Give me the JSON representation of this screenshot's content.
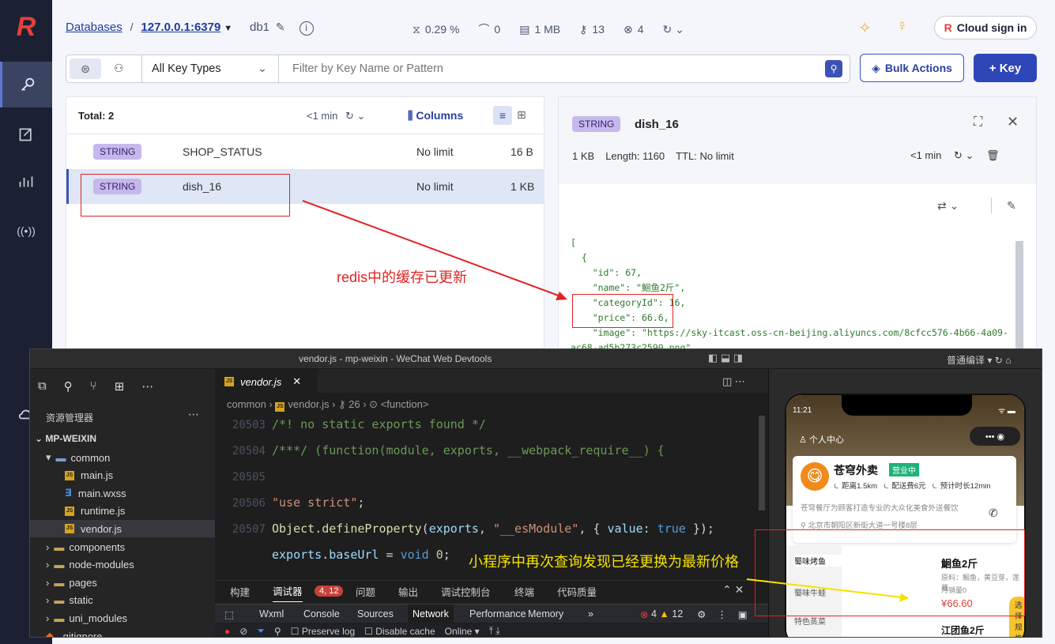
{
  "topbar": {
    "databases": "Databases",
    "sep": "/",
    "host": "127.0.0.1:6379",
    "db": "db1",
    "cpu": "0.29 %",
    "ops": "0",
    "mem": "1 MB",
    "keys": "13",
    "clients": "4",
    "cloud": "Cloud sign in"
  },
  "filter": {
    "type": "All Key Types",
    "placeholder": "Filter by Key Name or Pattern",
    "bulk": "Bulk Actions",
    "add": "+ Key"
  },
  "list": {
    "total": "Total: 2",
    "refresh": "<1 min",
    "columns": "Columns",
    "rows": [
      {
        "type": "STRING",
        "name": "SHOP_STATUS",
        "ttl": "No limit",
        "size": "16 B"
      },
      {
        "type": "STRING",
        "name": "dish_16",
        "ttl": "No limit",
        "size": "1 KB"
      }
    ]
  },
  "detail": {
    "type": "STRING",
    "key": "dish_16",
    "size": "1 KB",
    "length": "Length: 1160",
    "ttl": "TTL:  No limit",
    "refresh": "<1 min",
    "json": [
      "[",
      "  {",
      "    \"id\": 67,",
      "    \"name\": \"鮰鱼2斤\",",
      "    \"categoryId\": 16,",
      "    \"price\": 66.6,",
      "    \"image\": \"https://sky-itcast.oss-cn-beijing.aliyuncs.com/8cfcc576-4b66-4a09-",
      "ac68-ad5b273c2590.png\","
    ]
  },
  "annotation1": "redis中的缓存已更新",
  "annotation2": "小程序中再次查询发现已经更换为最新价格",
  "devtools": {
    "title": "vendor.js - mp-weixin - WeChat Web Devtools",
    "tab": "vendor.js",
    "breadcrumb": [
      "common",
      "vendor.js",
      "26",
      "<function>"
    ],
    "explorer": "资源管理器",
    "root": "MP-WEIXIN",
    "tree": [
      {
        "label": "common",
        "indent": 1,
        "kind": "folder-open"
      },
      {
        "label": "main.js",
        "indent": 2,
        "kind": "js"
      },
      {
        "label": "main.wxss",
        "indent": 2,
        "kind": "css"
      },
      {
        "label": "runtime.js",
        "indent": 2,
        "kind": "js"
      },
      {
        "label": "vendor.js",
        "indent": 2,
        "kind": "js"
      },
      {
        "label": "components",
        "indent": 1,
        "kind": "folder"
      },
      {
        "label": "node-modules",
        "indent": 1,
        "kind": "folder"
      },
      {
        "label": "pages",
        "indent": 1,
        "kind": "folder"
      },
      {
        "label": "static",
        "indent": 1,
        "kind": "folder"
      },
      {
        "label": "uni_modules",
        "indent": 1,
        "kind": "folder"
      },
      {
        "label": ".gitignore",
        "indent": 1,
        "kind": "file"
      }
    ],
    "lines": [
      {
        "n": "20503",
        "t": "/*! no static exports found */"
      },
      {
        "n": "20504",
        "t": "/***/ (function(module, exports, __webpack_require__) {"
      },
      {
        "n": "20505",
        "t": ""
      },
      {
        "n": "20506",
        "t": "\"use strict\";"
      },
      {
        "n": "20507",
        "t": "Object.defineProperty(exports, \"__esModule\", { value: true });"
      },
      {
        "n": "",
        "t": "exports.baseUrl = void 0;"
      }
    ],
    "paneltabs": [
      "构建",
      "调试器",
      "问题",
      "输出",
      "调试控制台",
      "终端",
      "代码质量"
    ],
    "badge": "4, 12",
    "tools": [
      "Wxml",
      "Console",
      "Sources",
      "Network",
      "Performance",
      "Memory"
    ],
    "errors": "4",
    "warns": "12",
    "netbar": [
      "Preserve log",
      "Disable cache",
      "Online"
    ],
    "compile": "普通编译"
  },
  "phone": {
    "time": "11:21",
    "personal": "个人中心",
    "shop": "苍穹外卖",
    "open": "营业中",
    "dist": "距离1.5km",
    "fee": "配送费6元",
    "eta": "预计时长12min",
    "desc": "苍穹餐厅为顾客打造专业的大众化美食外送餐饮",
    "addr": "北京市朝阳区新街大道一号楼8层",
    "cats": [
      "蜀味烤鱼",
      "蜀味牛蛙",
      "特色蒸菜"
    ],
    "dish": "鮰鱼2斤",
    "ing": "原料：鮰鱼，黄豆芽，莲藕",
    "sales": "月销量0",
    "price": "¥66.60",
    "spec": "选择规格",
    "dish2": "江团鱼2斤"
  }
}
